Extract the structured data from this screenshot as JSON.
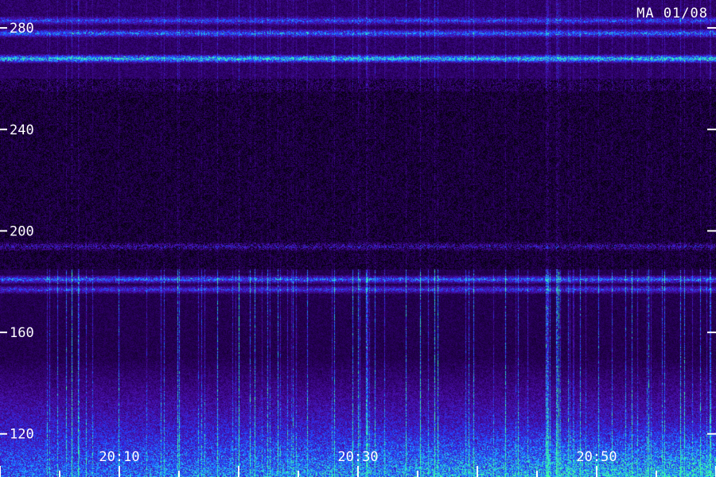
{
  "station_label": "MA 01/08",
  "chart_data": {
    "type": "heatmap",
    "title": "",
    "xlabel": "",
    "ylabel": "",
    "ylim": [
      103,
      291
    ],
    "xlim": [
      "20:00",
      "20:60"
    ],
    "y_ticks": [
      {
        "value": 120,
        "label": "120"
      },
      {
        "value": 160,
        "label": "160"
      },
      {
        "value": 200,
        "label": "200"
      },
      {
        "value": 240,
        "label": "240"
      },
      {
        "value": 280,
        "label": "280"
      }
    ],
    "x_ticks": [
      {
        "value": "20:10",
        "label": "20:10"
      },
      {
        "value": "20:30",
        "label": "20:30"
      },
      {
        "value": "20:50",
        "label": "20:50"
      }
    ],
    "colormap": [
      "#000000",
      "#2a0060",
      "#4a10b0",
      "#2040ff",
      "#20b0ff",
      "#40ffa0"
    ],
    "horizontal_bands": [
      {
        "y": 283,
        "intensity": 0.45
      },
      {
        "y": 278,
        "intensity": 0.55
      },
      {
        "y": 268,
        "intensity": 0.85
      },
      {
        "y": 194,
        "intensity": 0.35
      },
      {
        "y": 181,
        "intensity": 0.6
      },
      {
        "y": 177,
        "intensity": 0.45
      }
    ]
  }
}
